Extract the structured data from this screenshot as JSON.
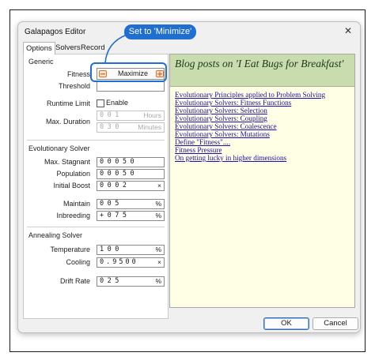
{
  "window": {
    "title": "Galapagos Editor",
    "close_glyph": "✕"
  },
  "tabs": [
    {
      "label": "Options",
      "active": true
    },
    {
      "label": "Solvers",
      "active": false
    },
    {
      "label": "Record",
      "active": false
    }
  ],
  "generic": {
    "group": "Generic",
    "fitness_label": "Fitness",
    "fitness_value": "Maximize",
    "fitness_icon_minus": "minus-icon",
    "fitness_icon_plus": "plus-icon",
    "threshold_label": "Threshold",
    "threshold_value": "",
    "runtime_label": "Runtime Limit",
    "runtime_enable": "Enable",
    "runtime_checked": false,
    "duration_label": "Max. Duration",
    "hours_digits": "001",
    "hours_unit": "Hours",
    "minutes_digits": "030",
    "minutes_unit": "Minutes"
  },
  "evolutionary": {
    "group": "Evolutionary Solver",
    "stagnant_label": "Max. Stagnant",
    "stagnant_digits": "00050",
    "population_label": "Population",
    "population_digits": "00050",
    "boost_label": "Initial Boost",
    "boost_digits": "0002",
    "boost_unit": "×",
    "maintain_label": "Maintain",
    "maintain_digits": "005",
    "maintain_unit": "%",
    "inbreeding_label": "Inbreeding",
    "inbreeding_digits": "+075",
    "inbreeding_unit": "%"
  },
  "annealing": {
    "group": "Annealing Solver",
    "temperature_label": "Temperature",
    "temperature_digits": "100",
    "temperature_unit": "%",
    "cooling_label": "Cooling",
    "cooling_digits": "0.9500",
    "cooling_unit": "×",
    "drift_label": "Drift Rate",
    "drift_digits": "025",
    "drift_unit": "%"
  },
  "blog": {
    "title": "Blog posts on 'I Eat Bugs for Breakfast'",
    "links": [
      "Evolutionary Principles applied to Problem Solving",
      "Evolutionary Solvers: Fitness Functions",
      "Evolutionary Solvers: Selection",
      "Evolutionary Solvers: Coupling",
      "Evolutionary Solvers: Coalescence",
      "Evolutionary Solvers: Mutations",
      "Define \"Fitness\"....",
      "Fitness Pressure",
      "On getting lucky in higher dimensions"
    ]
  },
  "buttons": {
    "ok": "OK",
    "cancel": "Cancel"
  },
  "callout": {
    "text": "Set to 'Minimize'"
  },
  "colors": {
    "accent": "#1f6fd1",
    "blog_header": "#c9dcae",
    "blog_background": "#ffffe6",
    "link": "#1a0dab",
    "minus_icon": "#e0712b",
    "plus_icon": "#e0712b"
  }
}
